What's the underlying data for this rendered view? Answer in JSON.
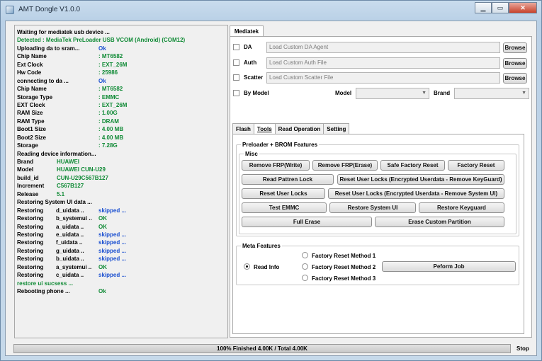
{
  "window": {
    "title": "AMT Dongle V1.0.0",
    "buttons": {
      "minimize": "▁",
      "maximize": "▭",
      "close": "✕"
    }
  },
  "log": [
    {
      "label": "Waiting for mediatek usb device ...",
      "value": "",
      "color": "black"
    },
    {
      "label": "Detected  :  MediaTek PreLoader USB VCOM (Android) (COM12)",
      "value": "",
      "color": "green"
    },
    {
      "label": "Uploading da to sram...",
      "value": "Ok",
      "color": "blue"
    },
    {
      "label": "Chip Name",
      "value": ": MT6582",
      "color": "green"
    },
    {
      "label": "Ext Clock",
      "value": ": EXT_26M",
      "color": "green"
    },
    {
      "label": "Hw Code",
      "value": ": 25986",
      "color": "green"
    },
    {
      "label": "connecting to da ...",
      "value": "Ok",
      "color": "blue"
    },
    {
      "label": "Chip Name",
      "value": ": MT6582",
      "color": "green"
    },
    {
      "label": "Storage Type",
      "value": ": EMMC",
      "color": "green"
    },
    {
      "label": "EXT Clock",
      "value": ": EXT_26M",
      "color": "green"
    },
    {
      "label": "RAM Size",
      "value": ": 1.00G",
      "color": "green"
    },
    {
      "label": "RAM Type",
      "value": ": DRAM",
      "color": "green"
    },
    {
      "label": "Boot1 Size",
      "value": ": 4.00 MB",
      "color": "green"
    },
    {
      "label": "Boot2 Size",
      "value": ": 4.00 MB",
      "color": "green"
    },
    {
      "label": "Storage",
      "value": ": 7.28G",
      "color": "green"
    },
    {
      "label": "Reading device information...",
      "value": "",
      "color": "black"
    },
    {
      "label": "Brand",
      "value": "HUAWEI",
      "color": "green",
      "short": true
    },
    {
      "label": "Model",
      "value": "HUAWEI CUN-U29",
      "color": "green",
      "short": true
    },
    {
      "label": "build_id",
      "value": "CUN-U29C567B127",
      "color": "green",
      "short": true
    },
    {
      "label": "Increment",
      "value": "C567B127",
      "color": "green",
      "short": true
    },
    {
      "label": "Release",
      "value": "5.1",
      "color": "green",
      "short": true
    },
    {
      "label": "Restoring System UI data ...",
      "value": "",
      "color": "black"
    },
    {
      "label": "Restoring",
      "part": "d_uidata ..",
      "value": "skipped ...",
      "color": "blue"
    },
    {
      "label": "Restoring",
      "part": "b_systemui ..",
      "value": "OK",
      "color": "green"
    },
    {
      "label": "Restoring",
      "part": "a_uidata ..",
      "value": "OK",
      "color": "green"
    },
    {
      "label": "Restoring",
      "part": "e_uidata ..",
      "value": "skipped ...",
      "color": "blue"
    },
    {
      "label": "Restoring",
      "part": "f_uidata ..",
      "value": "skipped ...",
      "color": "blue"
    },
    {
      "label": "Restoring",
      "part": "g_uidata ..",
      "value": "skipped ...",
      "color": "blue"
    },
    {
      "label": "Restoring",
      "part": "b_uidata ..",
      "value": "skipped ...",
      "color": "blue"
    },
    {
      "label": "Restoring",
      "part": "a_systemui ..",
      "value": "OK",
      "color": "green"
    },
    {
      "label": "Restoring",
      "part": "c_uidata ..",
      "value": "skipped ...",
      "color": "blue"
    },
    {
      "label": "restore ui sucsess ...",
      "value": "",
      "color": "green"
    },
    {
      "label": "Rebooting phone ...",
      "value": "Ok",
      "color": "green"
    }
  ],
  "main_tab": "Mediatek",
  "files": {
    "da": {
      "label": "DA",
      "placeholder": "Load Custom DA Agent",
      "browse": "Browse"
    },
    "auth": {
      "label": "Auth",
      "placeholder": "Load Custom Auth File",
      "browse": "Browse"
    },
    "scatter": {
      "label": "Scatter",
      "placeholder": "Load Custom Scatter File",
      "browse": "Browse"
    }
  },
  "bymodel": {
    "label": "By Model",
    "model_label": "Model",
    "brand_label": "Brand"
  },
  "subtabs": {
    "flash": "Flash",
    "tools": "Tools",
    "read": "Read Operation",
    "setting": "Setting"
  },
  "preloader": {
    "title": "Preloader + BROM Features",
    "misc_title": "Misc",
    "buttons": {
      "remove_frp_write": "Remove FRP(Write)",
      "remove_frp_erase": "Remove FRP(Erase)",
      "safe_factory_reset": "Safe Factory Reset",
      "factory_reset": "Factory Reset",
      "read_pattern_lock": "Read Pattren Lock",
      "reset_user_locks_keyguard": "Reset User Locks (Encrypted Userdata - Remove KeyGuard)",
      "reset_user_locks": "Reset User Locks",
      "reset_user_locks_systemui": "Reset User Locks (Encrypted Userdata - Remove System UI)",
      "test_emmc": "Test EMMC",
      "restore_system_ui": "Restore System UI",
      "restore_keyguard": "Restore Keyguard",
      "full_erase": "Full Erase",
      "erase_custom_partition": "Erase Custom Partition"
    }
  },
  "meta": {
    "title": "Meta Features",
    "read_info": "Read Info",
    "method1": "Factory Reset Method 1",
    "method2": "Factory Reset Method 2",
    "method3": "Factory Reset Method 3",
    "perform": "Peform Job"
  },
  "status": {
    "progress_text": "100% Finished 4.00K / Total 4.00K",
    "progress": 1.0,
    "stop": "Stop"
  }
}
